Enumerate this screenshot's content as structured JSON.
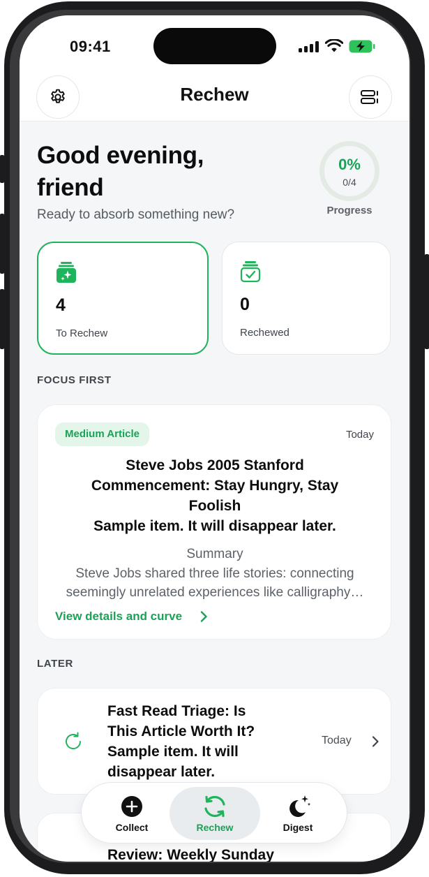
{
  "status_bar": {
    "time": "09:41"
  },
  "header": {
    "title": "Rechew",
    "settings_icon": "gear-icon",
    "view_icon": "list-view-icon"
  },
  "greeting": {
    "line1": "Good evening,",
    "line2": "friend",
    "subtitle": "Ready to absorb something new?"
  },
  "progress": {
    "percent": "0%",
    "count": "0/4",
    "label": "Progress"
  },
  "stats": [
    {
      "value": "4",
      "label": "To Rechew",
      "icon": "sparkle-stack-icon"
    },
    {
      "value": "0",
      "label": "Rechewed",
      "icon": "check-stack-icon"
    }
  ],
  "focus_section": {
    "heading": "FOCUS FIRST",
    "tag": "Medium Article",
    "date": "Today",
    "title_line1": "Steve Jobs 2005 Stanford",
    "title_line2": "Commencement: Stay Hungry, Stay",
    "title_line3": "Foolish",
    "title_line4": "Sample item. It will disappear later.",
    "summary_label": "Summary",
    "summary_line1": "Steve Jobs shared three life stories: connecting",
    "summary_line2": "seemingly unrelated experiences like calligraphy…",
    "link": "View details and curve"
  },
  "later_section": {
    "heading": "LATER",
    "items": [
      {
        "title_line1": "Fast Read Triage: Is",
        "title_line2": "This Article Worth It?",
        "title_line3": "Sample item. It will",
        "title_line4": "disappear later.",
        "date": "Today"
      },
      {
        "title_line1": "Review: Weekly Sunday"
      }
    ]
  },
  "tab_bar": {
    "tabs": [
      {
        "label": "Collect",
        "icon": "plus-circle-icon",
        "active": false
      },
      {
        "label": "Rechew",
        "icon": "refresh-icon",
        "active": true
      },
      {
        "label": "Digest",
        "icon": "moon-stars-icon",
        "active": false
      }
    ]
  },
  "colors": {
    "accent": "#1aa356",
    "background": "#f4f6f8",
    "card": "#ffffff"
  }
}
